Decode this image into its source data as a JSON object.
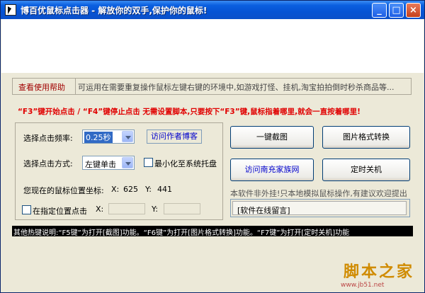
{
  "window": {
    "title": "博百优鼠标点击器 - 解放你的双手,保护你的鼠标!",
    "controls": {
      "minimize": "_",
      "maximize": "□",
      "close": "×"
    }
  },
  "help": {
    "link": "查看使用帮助",
    "description": "可运用在需要重复操作鼠标左键右键的环境中,如游戏打怪、挂机,淘宝拍拍倒时秒杀商品等..."
  },
  "notice": "“F3”键开始点击 / “F4”键停止点击  无需设置脚本,只要按下“F3”键,鼠标指着哪里,就会一直按着哪里!",
  "settings": {
    "frequency_label": "选择点击频率:",
    "frequency_value": "0.25秒",
    "visit_author_blog": "访问作者博客",
    "method_label": "选择点击方式:",
    "method_value": "左键单击",
    "minimize_to_tray": "最小化至系统托盘",
    "mouse_position_label": "您现在的鼠标位置坐标:",
    "mouse_x_label": "X:",
    "mouse_x": "625",
    "mouse_y_label": "Y:",
    "mouse_y": "441",
    "fixed_position_label": "在指定位置点击",
    "fixed_x_label": "X:",
    "fixed_y_label": "Y:"
  },
  "actions": {
    "screenshot": "一键截图",
    "image_convert": "图片格式转换",
    "visit_site": "访问南充家族网",
    "shutdown_timer": "定时关机"
  },
  "right_notice": "本软件非外挂!只本地模拟鼠标操作,有建议欢迎提出",
  "online_message": "[软件在线留言]",
  "hotkeys": "其他热键说明:“F5键”为打开[截图]功能。“F6键”为打开[图片格式转换]功能。“F7键”为打开[定时关机]功能",
  "watermark": {
    "main": "脚本之家",
    "sub": "www.jb51.net"
  }
}
